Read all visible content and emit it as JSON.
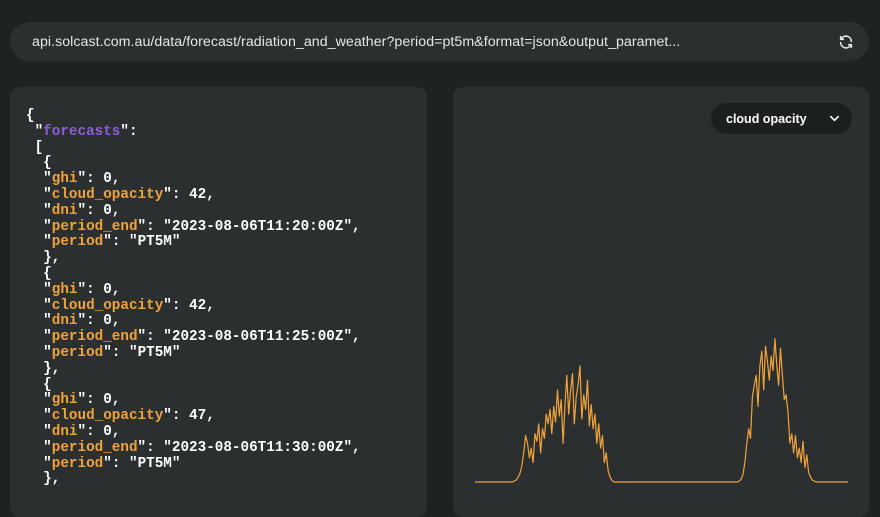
{
  "browser": {
    "url": "api.solcast.com.au/data/forecast/radiation_and_weather?period=pt5m&format=json&output_paramet..."
  },
  "json_view": {
    "root_key": "forecasts",
    "entries": [
      {
        "ghi": "0",
        "cloud_opacity": "42",
        "dni": "0",
        "period_end": "\"2023-08-06T11:20:00Z\"",
        "period": "\"PT5M\""
      },
      {
        "ghi": "0",
        "cloud_opacity": "42",
        "dni": "0",
        "period_end": "\"2023-08-06T11:25:00Z\"",
        "period": "\"PT5M\""
      },
      {
        "ghi": "0",
        "cloud_opacity": "47",
        "dni": "0",
        "period_end": "\"2023-08-06T11:30:00Z\"",
        "period": "\"PT5M\""
      }
    ]
  },
  "chart_panel": {
    "dropdown_label": "cloud opacity"
  },
  "chart_data": {
    "type": "line",
    "series": [
      {
        "values": [
          0,
          0,
          0,
          0,
          0,
          0,
          0,
          0,
          0,
          0,
          0,
          0,
          0,
          0,
          0,
          0,
          0,
          0,
          0,
          0,
          0,
          1,
          2,
          5,
          9,
          17,
          30,
          48,
          40,
          25,
          35,
          20,
          50,
          42,
          60,
          30,
          55,
          45,
          70,
          60,
          75,
          50,
          78,
          62,
          95,
          68,
          85,
          40,
          80,
          110,
          70,
          95,
          112,
          60,
          88,
          100,
          120,
          65,
          90,
          75,
          105,
          58,
          80,
          55,
          70,
          40,
          60,
          35,
          48,
          20,
          30,
          12,
          5,
          2,
          0,
          0,
          0,
          0,
          0,
          0,
          0,
          0,
          0,
          0,
          0,
          0,
          0,
          0,
          0,
          0,
          0,
          0,
          0,
          0,
          0,
          0,
          0,
          0,
          0,
          0,
          0,
          0,
          0,
          0,
          0,
          0,
          0,
          0,
          0,
          0,
          0,
          0,
          0,
          0,
          0,
          0,
          0,
          0,
          0,
          0,
          0,
          0,
          0,
          0,
          0,
          0,
          0,
          0,
          0,
          0,
          0,
          0,
          0,
          0,
          0,
          0,
          0,
          0,
          0,
          0,
          0,
          1,
          3,
          8,
          20,
          40,
          55,
          45,
          88,
          100,
          110,
          78,
          120,
          135,
          95,
          140,
          125,
          105,
          130,
          115,
          148,
          120,
          100,
          138,
          110,
          85,
          90,
          72,
          40,
          50,
          30,
          48,
          25,
          35,
          20,
          42,
          15,
          28,
          10,
          5,
          2,
          1,
          0,
          0,
          0,
          0,
          0,
          0,
          0,
          0,
          0,
          0,
          0,
          0,
          0,
          0,
          0,
          0,
          0,
          0
        ]
      }
    ],
    "color": "#f0a33a",
    "ylim": [
      0,
      160
    ]
  }
}
